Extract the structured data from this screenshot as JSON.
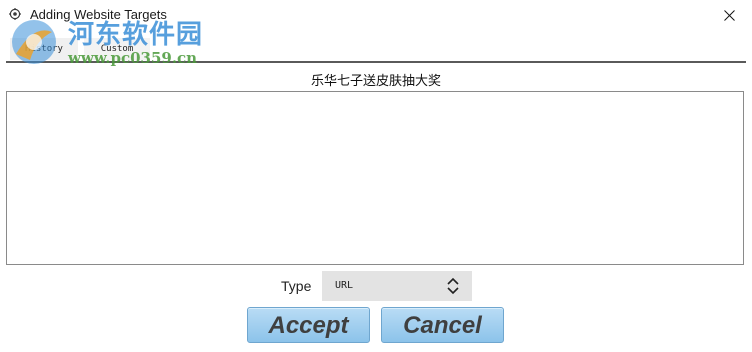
{
  "window": {
    "title": "Adding Website Targets"
  },
  "watermark": {
    "name": "河东软件园",
    "url": "www.pc0359.cn"
  },
  "tabs": [
    {
      "label": "History"
    },
    {
      "label": "Custom"
    }
  ],
  "content": {
    "heading": "乐华七子送皮肤抽大奖",
    "textarea_value": ""
  },
  "type_field": {
    "label": "Type",
    "selected": "URL"
  },
  "buttons": {
    "accept_label": "Accept",
    "cancel_label": "Cancel"
  },
  "colors": {
    "button_fill": "#8cc3ea",
    "watermark_blue": "#3a8fd8",
    "watermark_green": "#4a9a3a"
  },
  "icons": {
    "app": "app-gear-icon",
    "close": "close-icon",
    "select": "updown-chevron-icon",
    "watermark_logo": "watermark-logo-icon"
  }
}
